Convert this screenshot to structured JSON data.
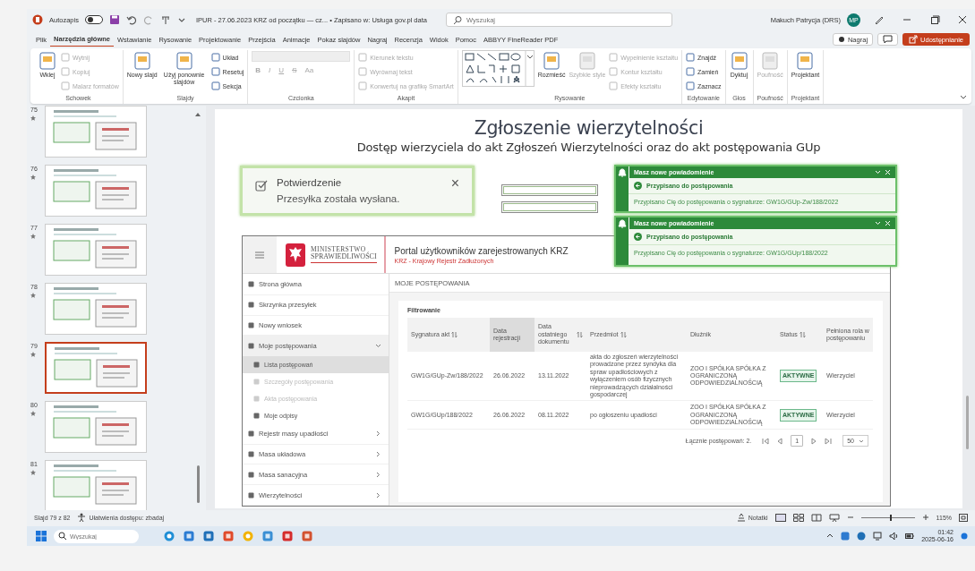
{
  "titlebar": {
    "autosave_label": "Autozapis",
    "autosave_on": false,
    "doc_title": "IPUR - 27.06.2023 KRZ od początku — cz... • Zapisano w: Usługa gov.pl data",
    "search_placeholder": "Wyszukaj",
    "user": "Makuch Patrycja (DRS)",
    "avatar": "MP"
  },
  "menu": {
    "tabs": [
      {
        "label": "Plik",
        "selected": false
      },
      {
        "label": "Narzędzia główne",
        "selected": true
      },
      {
        "label": "Wstawianie",
        "selected": false
      },
      {
        "label": "Rysowanie",
        "selected": false
      },
      {
        "label": "Projektowanie",
        "selected": false
      },
      {
        "label": "Przejścia",
        "selected": false
      },
      {
        "label": "Animacje",
        "selected": false
      },
      {
        "label": "Pokaz slajdów",
        "selected": false
      },
      {
        "label": "Nagraj",
        "selected": false
      },
      {
        "label": "Recenzja",
        "selected": false
      },
      {
        "label": "Widok",
        "selected": false
      },
      {
        "label": "Pomoc",
        "selected": false
      },
      {
        "label": "ABBYY FineReader PDF",
        "selected": false
      }
    ],
    "record": "Nagraj",
    "share": "Udostępnianie"
  },
  "ribbon": [
    {
      "label": "Schowek",
      "items": [
        {
          "kind": "large",
          "label": "Wklej",
          "disabled": false
        },
        {
          "kind": "small",
          "label": "Wytnij",
          "disabled": true
        },
        {
          "kind": "small",
          "label": "Kopiuj",
          "disabled": true
        },
        {
          "kind": "small",
          "label": "Malarz formatów",
          "disabled": true
        }
      ]
    },
    {
      "label": "Slajdy",
      "items": [
        {
          "kind": "large",
          "label": "Nowy slajd",
          "disabled": false
        },
        {
          "kind": "large",
          "label": "Użyj ponownie slajdów",
          "disabled": false
        },
        {
          "kind": "small",
          "label": "Układ",
          "disabled": false
        },
        {
          "kind": "small",
          "label": "Resetuj",
          "disabled": false
        },
        {
          "kind": "small",
          "label": "Sekcja",
          "disabled": false
        }
      ]
    },
    {
      "label": "Czcionka",
      "items": [
        {
          "kind": "field",
          "disabled": true
        },
        {
          "kind": "glyph",
          "label": "B",
          "disabled": true
        },
        {
          "kind": "glyph",
          "label": "I",
          "disabled": true
        },
        {
          "kind": "glyph",
          "label": "U",
          "disabled": true
        },
        {
          "kind": "glyph",
          "label": "S",
          "disabled": true
        },
        {
          "kind": "glyph",
          "label": "Aa",
          "disabled": true
        }
      ]
    },
    {
      "label": "Akapit",
      "items": [
        {
          "kind": "small",
          "label": "Kierunek tekstu",
          "disabled": true
        },
        {
          "kind": "small",
          "label": "Wyrównaj tekst",
          "disabled": true
        },
        {
          "kind": "small",
          "label": "Konwertuj na grafikę SmartArt",
          "disabled": true
        }
      ]
    },
    {
      "label": "Rysowanie",
      "items": [
        {
          "kind": "gallery",
          "disabled": false
        },
        {
          "kind": "large",
          "label": "Rozmieść",
          "disabled": false
        },
        {
          "kind": "large",
          "label": "Szybkie style",
          "disabled": true
        },
        {
          "kind": "small",
          "label": "Wypełnienie kształtu",
          "disabled": true
        },
        {
          "kind": "small",
          "label": "Kontur kształtu",
          "disabled": true
        },
        {
          "kind": "small",
          "label": "Efekty kształtu",
          "disabled": true
        }
      ]
    },
    {
      "label": "Edytowanie",
      "items": [
        {
          "kind": "small",
          "label": "Znajdź",
          "disabled": false
        },
        {
          "kind": "small",
          "label": "Zamień",
          "disabled": false
        },
        {
          "kind": "small",
          "label": "Zaznacz",
          "disabled": false
        }
      ]
    },
    {
      "label": "Głos",
      "items": [
        {
          "kind": "large",
          "label": "Dyktuj",
          "disabled": false
        }
      ]
    },
    {
      "label": "Poufność",
      "items": [
        {
          "kind": "large",
          "label": "Poufność",
          "disabled": true
        }
      ]
    },
    {
      "label": "Projektant",
      "items": [
        {
          "kind": "large",
          "label": "Projektant",
          "disabled": false
        }
      ]
    }
  ],
  "thumbnails": [
    {
      "number": "75",
      "selected": false
    },
    {
      "number": "76",
      "selected": false
    },
    {
      "number": "77",
      "selected": false
    },
    {
      "number": "78",
      "selected": false
    },
    {
      "number": "79",
      "selected": true
    },
    {
      "number": "80",
      "selected": false
    },
    {
      "number": "81",
      "selected": false
    }
  ],
  "slide": {
    "title": "Zgłoszenie wierzytelności",
    "subtitle": "Dostęp wierzyciela do akt Zgłoszeń Wierzytelności oraz do akt postępowania GUp",
    "toast": {
      "title": "Potwierdzenie",
      "message": "Przesyłka została wysłana.",
      "close": "×"
    },
    "notifications": [
      {
        "header": "Masz nowe powiadomienie",
        "title": "Przypisano do postępowania",
        "message": "Przypisano Cię do postępowania o sygnaturze: GW1G/GUp-Zw/188/2022"
      },
      {
        "header": "Masz nowe powiadomienie",
        "title": "Przypisano do postępowania",
        "message": "Przypisano Cię do postępowania o sygnaturze: GW1G/GUp/188/2022"
      }
    ],
    "portal": {
      "ministry_line1": "MINISTERSTWO",
      "ministry_line2": "SPRAWIEDLIWOŚCI",
      "title": "Portal użytkowników zarejestrowanych KRZ",
      "subtitle": "KRZ - Krajowy Rejestr Zadłużonych",
      "nav": [
        {
          "label": "Strona główna",
          "selected": false,
          "disabled": false
        },
        {
          "label": "Skrzynka przesyłek",
          "selected": false,
          "disabled": false
        },
        {
          "label": "Nowy wniosek",
          "selected": false,
          "disabled": false
        },
        {
          "label": "Moje postępowania",
          "selected": false,
          "disabled": false,
          "expanded": true,
          "children": [
            {
              "label": "Lista postępowań",
              "selected": true,
              "disabled": false
            },
            {
              "label": "Szczegóły postępowania",
              "selected": false,
              "disabled": true
            },
            {
              "label": "Akta postępowania",
              "selected": false,
              "disabled": true
            },
            {
              "label": "Moje odpisy",
              "selected": false,
              "disabled": false
            }
          ]
        },
        {
          "label": "Rejestr masy upadłości",
          "selected": false,
          "disabled": false,
          "has_submenu": true
        },
        {
          "label": "Masa układowa",
          "selected": false,
          "disabled": false,
          "has_submenu": true
        },
        {
          "label": "Masa sanacyjna",
          "selected": false,
          "disabled": false,
          "has_submenu": true
        },
        {
          "label": "Wierzytelności",
          "selected": false,
          "disabled": false,
          "has_submenu": true
        }
      ],
      "heading": "MOJE POSTĘPOWANIA",
      "filter_label": "Filtrowanie",
      "table": {
        "columns": [
          {
            "label": "Sygnatura akt",
            "sortable": true,
            "sorted": false,
            "kind": "text"
          },
          {
            "label": "Data rejestracji",
            "sortable": false,
            "sorted": true,
            "kind": "text"
          },
          {
            "label": "Data ostatniego dokumentu",
            "sortable": true,
            "sorted": false,
            "kind": "text"
          },
          {
            "label": "Przedmiot",
            "sortable": true,
            "sorted": false,
            "kind": "text"
          },
          {
            "label": "Dłużnik",
            "sortable": false,
            "sorted": false,
            "kind": "text"
          },
          {
            "label": "Status",
            "sortable": true,
            "sorted": false,
            "kind": "badge"
          },
          {
            "label": "Pełniona rola w postępowaniu",
            "sortable": false,
            "sorted": false,
            "kind": "text"
          }
        ],
        "rows": [
          [
            "GW1G/GUp-Zw/188/2022",
            "26.06.2022",
            "13.11.2022",
            "akta do zgłoszeń wierzytelności prowadzone przez syndyka dla spraw upadłościowych z wyłączeniem osób fizycznych nieprowadzących działalności gospodarczej",
            "ZOO I SPÓŁKA SPÓŁKA Z OGRANICZONĄ ODPOWIEDZIALNOŚCIĄ",
            "AKTYWNE",
            "Wierzyciel"
          ],
          [
            "GW1G/GUp/188/2022",
            "26.06.2022",
            "08.11.2022",
            "po ogłoszeniu upadłości",
            "ZOO I SPÓŁKA SPÓŁKA Z OGRANICZONĄ ODPOWIEDZIALNOŚCIĄ",
            "AKTYWNE",
            "Wierzyciel"
          ]
        ]
      },
      "pagination": {
        "total": "Łącznie postępowań: 2.",
        "page": "1",
        "per_page": "50"
      }
    }
  },
  "status_bar": {
    "slide": "Slajd 79 z 82",
    "accessibility": "Ułatwienia dostępu: zbadaj",
    "notes": "Notatki",
    "zoom": "115%",
    "level": 0.55
  },
  "taskbar": {
    "search_placeholder": "Wyszukaj",
    "time": "01:42",
    "date": "2025-06-16"
  }
}
